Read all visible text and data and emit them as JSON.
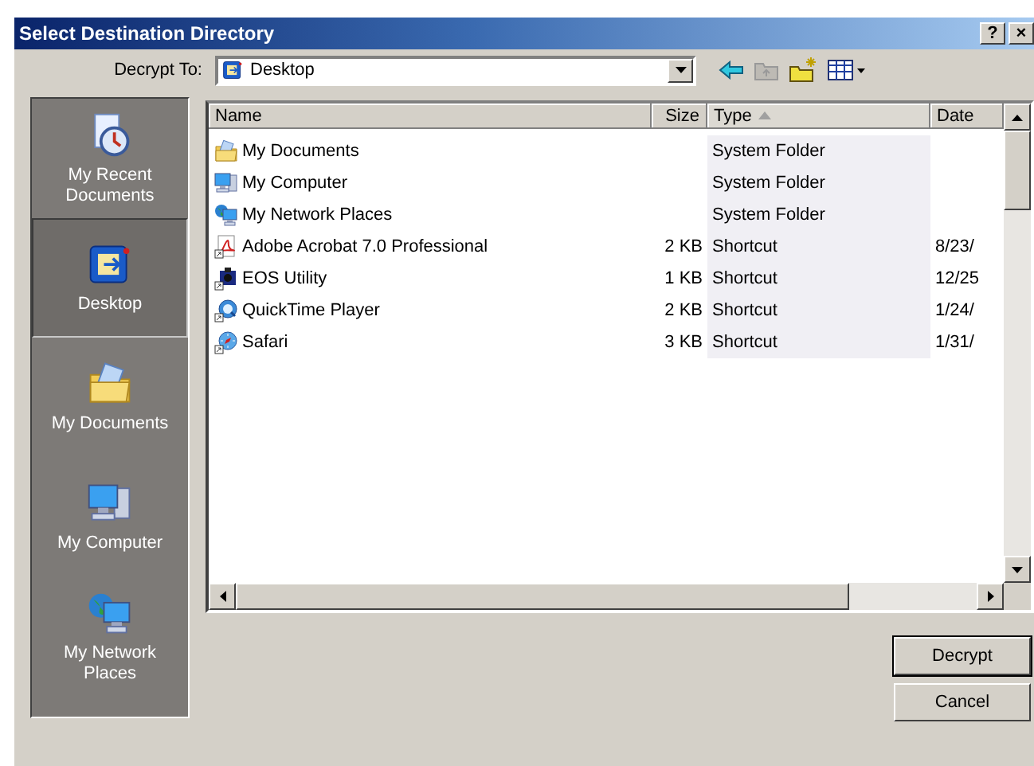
{
  "window": {
    "title": "Select Destination Directory",
    "help_button": "?",
    "close_button": "×"
  },
  "location": {
    "label": "Decrypt To:",
    "value": "Desktop"
  },
  "places": [
    {
      "label": "My Recent Documents",
      "selected": false
    },
    {
      "label": "Desktop",
      "selected": true
    },
    {
      "label": "My Documents",
      "selected": false
    },
    {
      "label": "My Computer",
      "selected": false
    },
    {
      "label": "My Network Places",
      "selected": false
    }
  ],
  "file_list": {
    "columns": [
      {
        "label": "Name",
        "sorted": false
      },
      {
        "label": "Size",
        "sorted": false
      },
      {
        "label": "Type",
        "sorted": true
      },
      {
        "label": "Date",
        "sorted": false
      }
    ],
    "rows": [
      {
        "name": "My Documents",
        "size": "",
        "type": "System Folder",
        "date": ""
      },
      {
        "name": "My Computer",
        "size": "",
        "type": "System Folder",
        "date": ""
      },
      {
        "name": "My Network Places",
        "size": "",
        "type": "System Folder",
        "date": ""
      },
      {
        "name": "Adobe Acrobat 7.0 Professional",
        "size": "2 KB",
        "type": "Shortcut",
        "date": "8/23/"
      },
      {
        "name": "EOS Utility",
        "size": "1 KB",
        "type": "Shortcut",
        "date": "12/25"
      },
      {
        "name": "QuickTime Player",
        "size": "2 KB",
        "type": "Shortcut",
        "date": "1/24/"
      },
      {
        "name": "Safari",
        "size": "3 KB",
        "type": "Shortcut",
        "date": "1/31/"
      }
    ]
  },
  "buttons": [
    {
      "label": "Decrypt",
      "default": true
    },
    {
      "label": "Cancel",
      "default": false
    }
  ]
}
